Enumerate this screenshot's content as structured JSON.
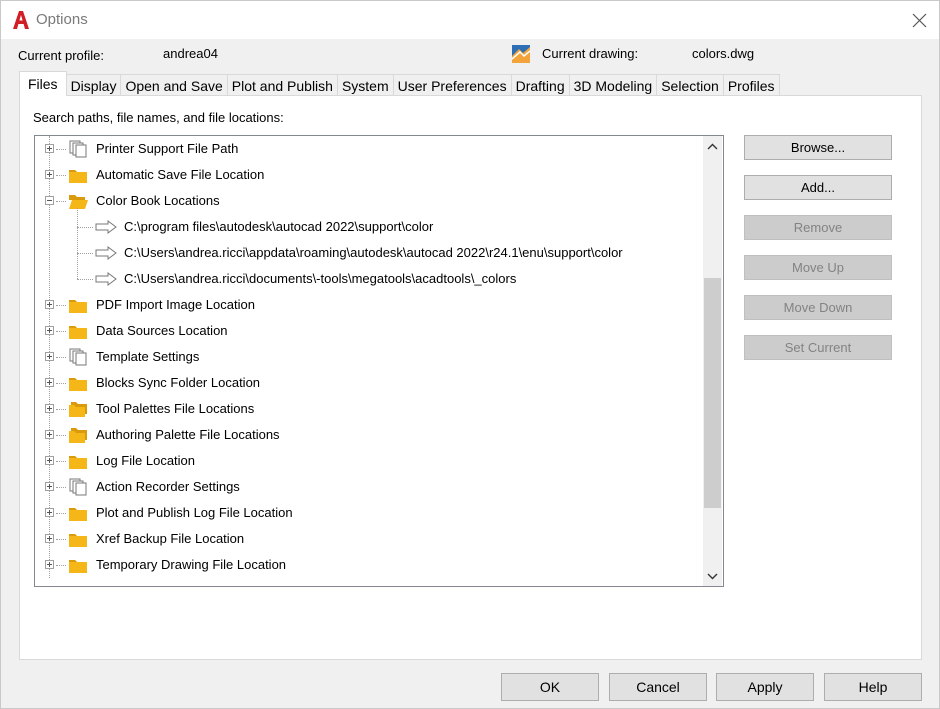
{
  "window": {
    "title": "Options"
  },
  "header": {
    "profile_label": "Current profile:",
    "profile_value": "andrea04",
    "drawing_label": "Current drawing:",
    "drawing_value": "colors.dwg"
  },
  "tabs": [
    {
      "label": "Files",
      "active": true
    },
    {
      "label": "Display"
    },
    {
      "label": "Open and Save"
    },
    {
      "label": "Plot and Publish"
    },
    {
      "label": "System"
    },
    {
      "label": "User Preferences"
    },
    {
      "label": "Drafting"
    },
    {
      "label": "3D Modeling"
    },
    {
      "label": "Selection"
    },
    {
      "label": "Profiles"
    }
  ],
  "panel": {
    "caption": "Search paths, file names, and file locations:"
  },
  "tree": {
    "items": [
      {
        "label": "Printer Support File Path",
        "icon": "file-stack-icon",
        "expanded": false
      },
      {
        "label": "Automatic Save File Location",
        "icon": "folder-icon",
        "expanded": false
      },
      {
        "label": "Color Book Locations",
        "icon": "folder-open-icon",
        "expanded": true,
        "children": [
          "C:\\program files\\autodesk\\autocad 2022\\support\\color",
          "C:\\Users\\andrea.ricci\\appdata\\roaming\\autodesk\\autocad 2022\\r24.1\\enu\\support\\color",
          "C:\\Users\\andrea.ricci\\documents\\-tools\\megatools\\acadtools\\_colors"
        ]
      },
      {
        "label": "PDF Import Image Location",
        "icon": "folder-icon",
        "expanded": false
      },
      {
        "label": "Data Sources Location",
        "icon": "folder-icon",
        "expanded": false
      },
      {
        "label": "Template Settings",
        "icon": "file-stack-icon",
        "expanded": false
      },
      {
        "label": "Blocks Sync Folder Location",
        "icon": "folder-icon",
        "expanded": false
      },
      {
        "label": "Tool Palettes File Locations",
        "icon": "folder-multi-icon",
        "expanded": false
      },
      {
        "label": "Authoring Palette File Locations",
        "icon": "folder-multi-icon",
        "expanded": false
      },
      {
        "label": "Log File Location",
        "icon": "folder-icon",
        "expanded": false
      },
      {
        "label": "Action Recorder Settings",
        "icon": "file-stack-icon",
        "expanded": false
      },
      {
        "label": "Plot and Publish Log File Location",
        "icon": "folder-icon",
        "expanded": false
      },
      {
        "label": "Xref Backup File Location",
        "icon": "folder-icon",
        "expanded": false
      },
      {
        "label": "Temporary Drawing File Location",
        "icon": "folder-icon",
        "expanded": false
      }
    ]
  },
  "buttons": {
    "browse": "Browse...",
    "add": "Add...",
    "remove": "Remove",
    "move_up": "Move Up",
    "move_down": "Move Down",
    "set_current": "Set Current"
  },
  "footer": {
    "ok": "OK",
    "cancel": "Cancel",
    "apply": "Apply",
    "help": "Help"
  },
  "colors": {
    "folder": "#f5b617",
    "app_red": "#d11f26",
    "scroll_thumb": "#cdcdcd"
  }
}
